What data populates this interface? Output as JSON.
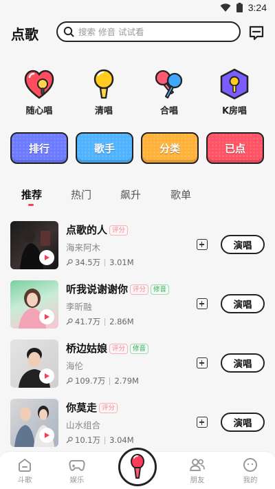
{
  "status_bar": {
    "time": "3:24",
    "icons": [
      "wifi-icon",
      "battery-icon"
    ]
  },
  "header": {
    "title": "点歌",
    "search": {
      "placeholder": "搜索 修音 试试看",
      "value": ""
    },
    "icons": [
      "search-icon",
      "message-icon"
    ]
  },
  "categories": [
    {
      "label": "随心唱",
      "icon": "heart-mic-icon",
      "color": "#ff4d5e"
    },
    {
      "label": "清唱",
      "icon": "mic-icon",
      "color": "#ffcc1f"
    },
    {
      "label": "合唱",
      "icon": "duet-mics-icon",
      "color": "#3fa7ff"
    },
    {
      "label": "K房唱",
      "icon": "k-room-icon",
      "color": "#7b5cff"
    }
  ],
  "quick_buttons": [
    {
      "label": "排行",
      "color": "#6d7cff"
    },
    {
      "label": "歌手",
      "color": "#4fb3ff"
    },
    {
      "label": "分类",
      "color": "#ffb23a"
    },
    {
      "label": "已点",
      "color": "#ff5466"
    }
  ],
  "tabs": [
    {
      "label": "推荐",
      "active": true
    },
    {
      "label": "热门",
      "active": false
    },
    {
      "label": "飙升",
      "active": false
    },
    {
      "label": "歌单",
      "active": false
    }
  ],
  "songs": [
    {
      "title": "点歌的人",
      "tags": [
        "评分"
      ],
      "artist": "海来阿木",
      "plays": "34.5万",
      "size": "3.01M",
      "sing_label": "演唱",
      "cover_colors": [
        "#1d1d1d",
        "#3a3230"
      ]
    },
    {
      "title": "听我说谢谢你",
      "tags": [
        "评分",
        "修音"
      ],
      "artist": "李昕融",
      "plays": "41.7万",
      "size": "2.86M",
      "sing_label": "演唱",
      "cover_colors": [
        "#7ad0a0",
        "#f6c6d1"
      ]
    },
    {
      "title": "桥边姑娘",
      "tags": [
        "评分",
        "修音"
      ],
      "artist": "海伦",
      "plays": "109.7万",
      "size": "2.79M",
      "sing_label": "演唱",
      "cover_colors": [
        "#d9d9d9",
        "#2a2a2a"
      ]
    },
    {
      "title": "你莫走",
      "tags": [
        "评分"
      ],
      "artist": "山水组合",
      "plays": "10.1万",
      "size": "3.04M",
      "sing_label": "演唱",
      "cover_colors": [
        "#c9c9c9",
        "#7a8aa0"
      ]
    }
  ],
  "tag_labels": {
    "rate": "评分",
    "mod": "修音"
  },
  "bottom_nav": [
    {
      "label": "斗歌",
      "icon": "home-icon"
    },
    {
      "label": "娱乐",
      "icon": "gamepad-icon"
    },
    {
      "label": "",
      "icon": "mic-record-icon"
    },
    {
      "label": "朋友",
      "icon": "friends-icon"
    },
    {
      "label": "我的",
      "icon": "profile-icon"
    }
  ],
  "colors": {
    "accent": "#ff3b5c",
    "text": "#222222",
    "muted": "#888888"
  }
}
